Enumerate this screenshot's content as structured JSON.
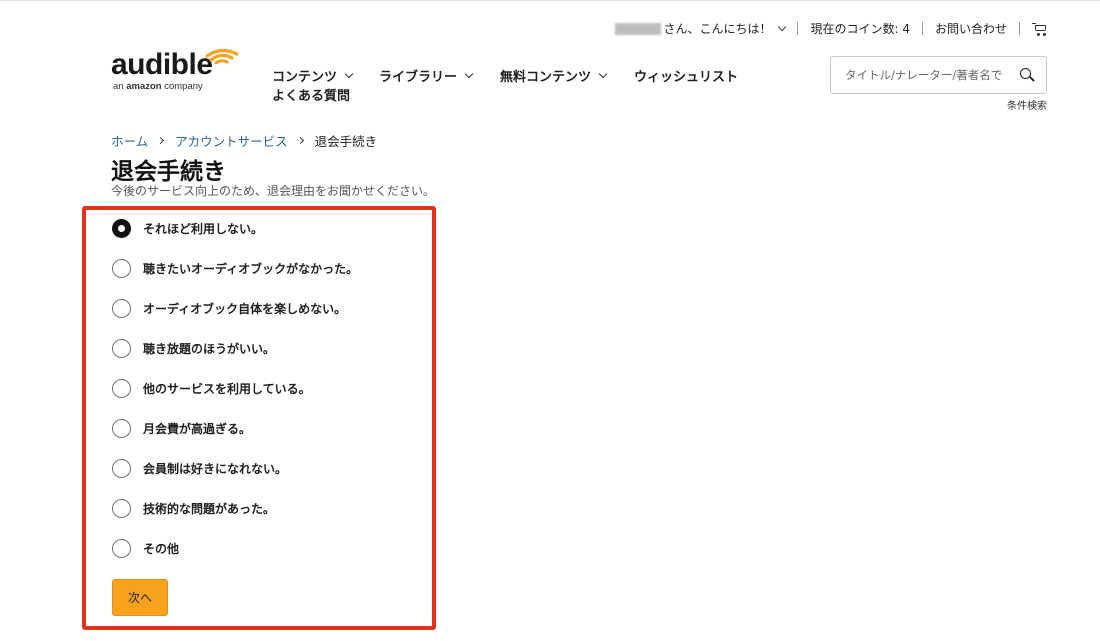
{
  "utility_bar": {
    "greeting": "さん、こんにちは！",
    "coins": "現在のコイン数: 4",
    "contact": "お問い合わせ"
  },
  "logo": {
    "word": "audible",
    "sub_prefix": "an ",
    "sub_brand": "amazon",
    "sub_suffix": " company"
  },
  "nav": {
    "items": [
      {
        "label": "コンテンツ"
      },
      {
        "label": "ライブラリー"
      },
      {
        "label": "無料コンテンツ"
      },
      {
        "label": "ウィッシュリスト"
      },
      {
        "label": "よくある質問"
      }
    ]
  },
  "search": {
    "placeholder": "タイトル/ナレーター/著者名で",
    "advanced": "条件検索"
  },
  "breadcrumb": {
    "home": "ホーム",
    "account": "アカウントサービス",
    "current": "退会手続き"
  },
  "page": {
    "title": "退会手続き",
    "subtitle": "今後のサービス向上のため、退会理由をお聞かせください。"
  },
  "options": [
    {
      "label": "それほど利用しない。",
      "checked": true
    },
    {
      "label": "聴きたいオーディオブックがなかった。",
      "checked": false
    },
    {
      "label": "オーディオブック自体を楽しめない。",
      "checked": false
    },
    {
      "label": "聴き放題のほうがいい。",
      "checked": false
    },
    {
      "label": "他のサービスを利用している。",
      "checked": false
    },
    {
      "label": "月会費が高過ぎる。",
      "checked": false
    },
    {
      "label": "会員制は好きになれない。",
      "checked": false
    },
    {
      "label": "技術的な問題があった。",
      "checked": false
    },
    {
      "label": "その他",
      "checked": false
    }
  ],
  "next_button": "次へ",
  "colors": {
    "accent": "#f7a21c",
    "highlight": "#e0321e",
    "link": "#2a6496"
  }
}
